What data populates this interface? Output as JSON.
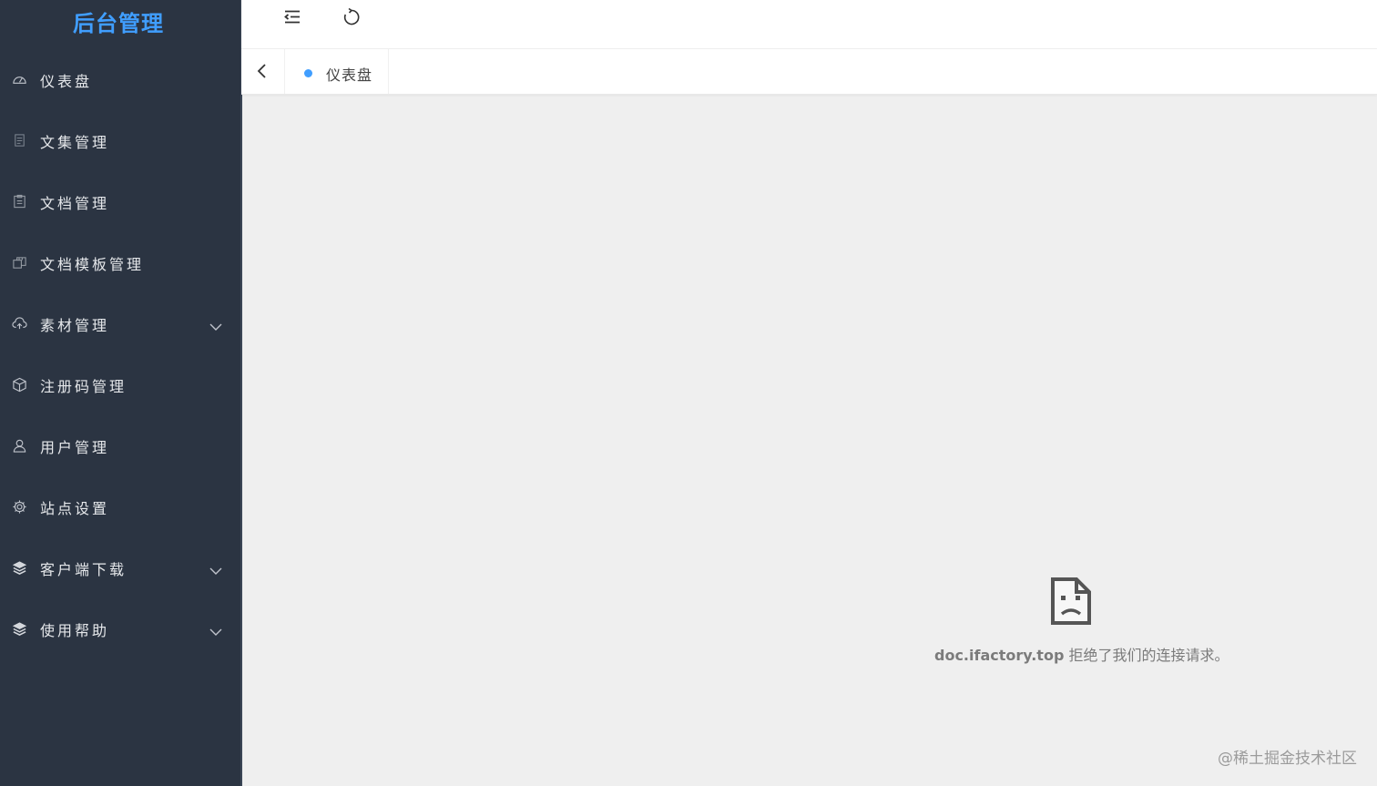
{
  "brand": {
    "title": "后台管理",
    "color": "#409eff"
  },
  "sidebar": {
    "background": "#2b3442",
    "items": [
      {
        "label": "仪表盘",
        "icon": "dashboard-icon",
        "expandable": false
      },
      {
        "label": "文集管理",
        "icon": "document-icon",
        "expandable": false
      },
      {
        "label": "文档管理",
        "icon": "notebook-icon",
        "expandable": false
      },
      {
        "label": "文档模板管理",
        "icon": "copy-document-icon",
        "expandable": false
      },
      {
        "label": "素材管理",
        "icon": "upload-cloud-icon",
        "expandable": true
      },
      {
        "label": "注册码管理",
        "icon": "box-icon",
        "expandable": false
      },
      {
        "label": "用户管理",
        "icon": "user-icon",
        "expandable": false
      },
      {
        "label": "站点设置",
        "icon": "setting-icon",
        "expandable": false
      },
      {
        "label": "客户端下载",
        "icon": "layers-icon",
        "expandable": true
      },
      {
        "label": "使用帮助",
        "icon": "layers-icon",
        "expandable": true
      }
    ]
  },
  "toolbar": {
    "collapse_icon": "fold-menu-icon",
    "refresh_icon": "refresh-icon"
  },
  "tabs": {
    "back_icon": "chevron-left-icon",
    "items": [
      {
        "label": "仪表盘",
        "active_dot_color": "#409eff"
      }
    ]
  },
  "content": {
    "error": {
      "icon": "sad-document-icon",
      "host": "doc.ifactory.top",
      "message": " 拒绝了我们的连接请求。"
    }
  },
  "watermark": "@稀土掘金技术社区"
}
